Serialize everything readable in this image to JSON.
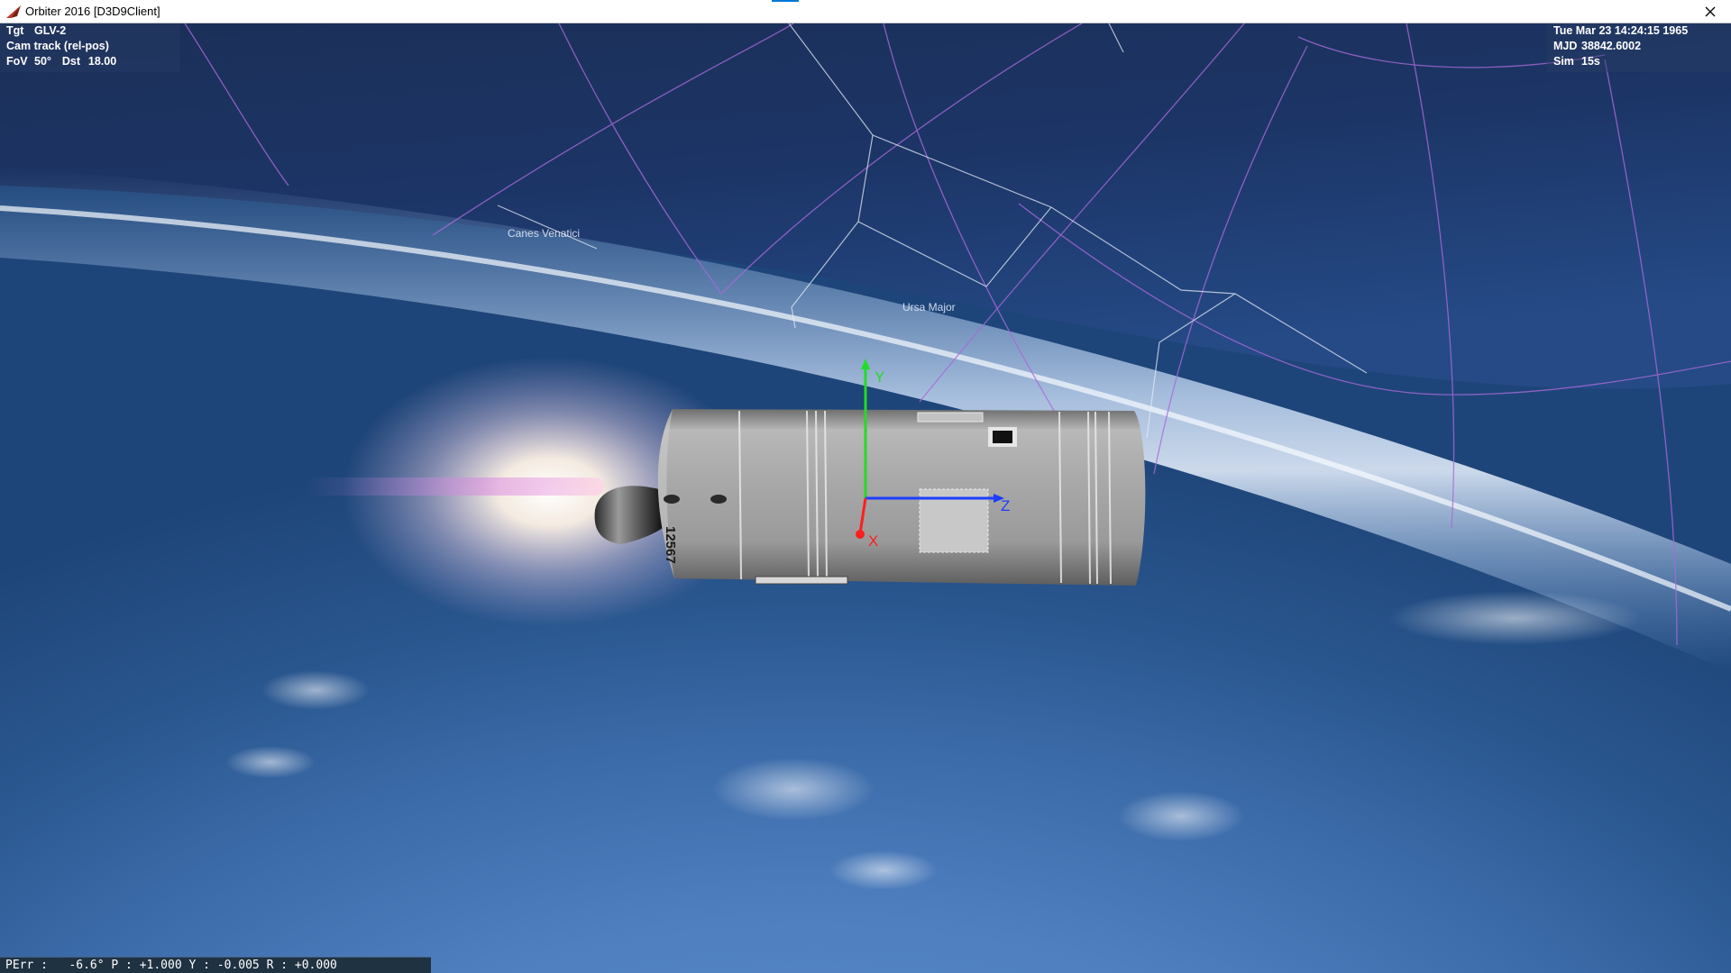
{
  "window": {
    "title": "Orbiter 2016 [D3D9Client]",
    "close_icon": "close-icon",
    "app_icon": "orbiter-app-icon"
  },
  "hud_left": {
    "tgt_label": "Tgt",
    "tgt_value": "GLV-2",
    "cam_mode": "Cam track (rel-pos)",
    "fov_label": "FoV",
    "fov_value": "50°",
    "dst_label": "Dst",
    "dst_value": "18.00"
  },
  "hud_right": {
    "date": "Tue Mar 23 14:24:15 1965",
    "mjd_label": "MJD",
    "mjd_value": "38842.6002",
    "sim_label": "Sim",
    "sim_value": "15s"
  },
  "constellations": {
    "canes": "Canes Venatici",
    "ursa": "Ursa Major"
  },
  "axes": {
    "x": "X",
    "y": "Y",
    "z": "Z"
  },
  "vehicle": {
    "serial": "12567"
  },
  "status_bar": {
    "text": "PErr :   -6.6° P : +1.000 Y : -0.005 R : +0.000"
  },
  "colors": {
    "accent": "#0078d7",
    "axis_x": "#ff1e1e",
    "axis_y": "#22dd22",
    "axis_z": "#1e3cff",
    "grid": "#a86ad8"
  }
}
